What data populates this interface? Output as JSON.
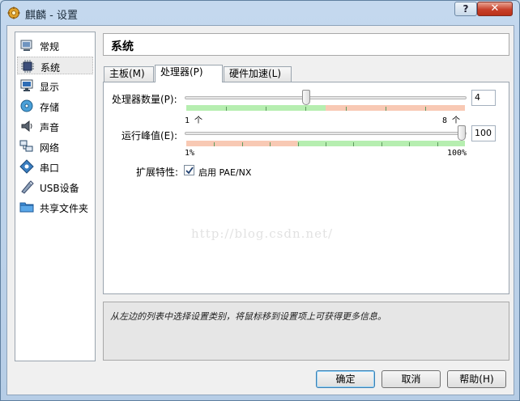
{
  "window": {
    "title": "麒麟 - 设置",
    "help_label": "?",
    "close_label": "✕"
  },
  "sidebar": {
    "items": [
      {
        "label": "常规",
        "icon": "general-icon"
      },
      {
        "label": "系统",
        "icon": "system-chip-icon",
        "selected": true
      },
      {
        "label": "显示",
        "icon": "display-monitor-icon"
      },
      {
        "label": "存储",
        "icon": "storage-disc-icon"
      },
      {
        "label": "声音",
        "icon": "speaker-icon"
      },
      {
        "label": "网络",
        "icon": "network-icon"
      },
      {
        "label": "串口",
        "icon": "serial-port-icon"
      },
      {
        "label": "USB设备",
        "icon": "usb-pen-icon"
      },
      {
        "label": "共享文件夹",
        "icon": "shared-folder-icon"
      }
    ]
  },
  "page": {
    "title": "系统"
  },
  "tabs": [
    {
      "label": "主板(M)"
    },
    {
      "label": "处理器(P)",
      "active": true
    },
    {
      "label": "硬件加速(L)"
    }
  ],
  "processor": {
    "count_label": "处理器数量(P):",
    "count_value": "4",
    "count_min_label": "1 个",
    "count_max_label": "8 个",
    "count_min": 1,
    "count_max": 8,
    "cap_label": "运行峰值(E):",
    "cap_value": "100",
    "cap_min_label": "1%",
    "cap_max_label": "100%",
    "ext_label": "扩展特性:",
    "pae_label": "启用 PAE/NX",
    "pae_checked": true
  },
  "watermark": "http://blog.csdn.net/",
  "info": {
    "text": "从左边的列表中选择设置类别，将鼠标移到设置项上可获得更多信息。"
  },
  "buttons": {
    "ok": "确定",
    "cancel": "取消",
    "help": "帮助(H)"
  },
  "colors": {
    "good_range": "#b6eeb0",
    "warn_range": "#f8c9b4",
    "selected_item": "#ececec"
  }
}
